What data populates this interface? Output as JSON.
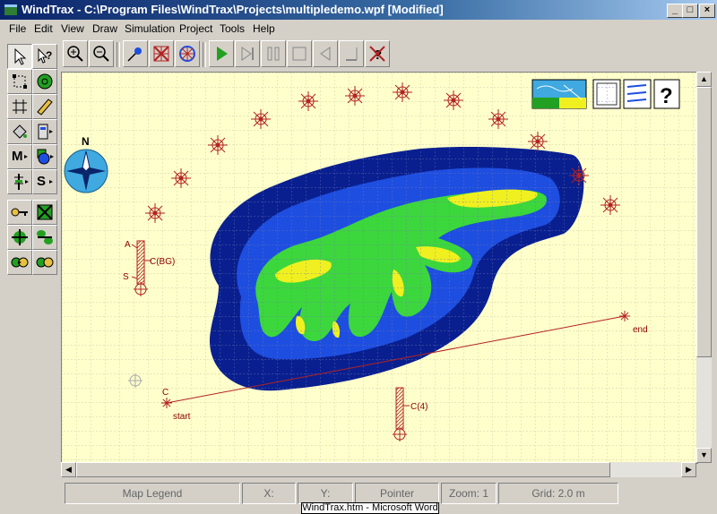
{
  "window": {
    "title": "WindTrax - C:\\Program Files\\WindTrax\\Projects\\multipledemo.wpf [Modified]",
    "min": "_",
    "max": "□",
    "close": "×"
  },
  "menu": [
    "File",
    "Edit",
    "View",
    "Draw",
    "Simulation",
    "Project",
    "Tools",
    "Help"
  ],
  "map": {
    "compass_label": "N",
    "sensor_labels": {
      "bg_top": "A",
      "bg_mid": "C(BG)",
      "bg_bottom": "S",
      "c4": "C(4)",
      "line_start_top": "C",
      "line_start": "start",
      "line_end": "end"
    }
  },
  "palette": {
    "m_label": "M",
    "s_label": "S"
  },
  "status": {
    "legend": "Map Legend",
    "x": "X:",
    "y": "Y:",
    "mode": "Pointer",
    "zoom": "Zoom: 1",
    "grid": "Grid: 2.0 m"
  },
  "taskbar_tip": "WindTrax.htm - Microsoft Word",
  "colors": {
    "accent": "#0a246a",
    "plume_outer": "#0a1f8f",
    "plume_mid": "#1e4ee0",
    "plume_inner": "#3cd73c",
    "plume_core": "#f0f020",
    "sensor": "#b22222",
    "canvas": "#ffffcc"
  }
}
